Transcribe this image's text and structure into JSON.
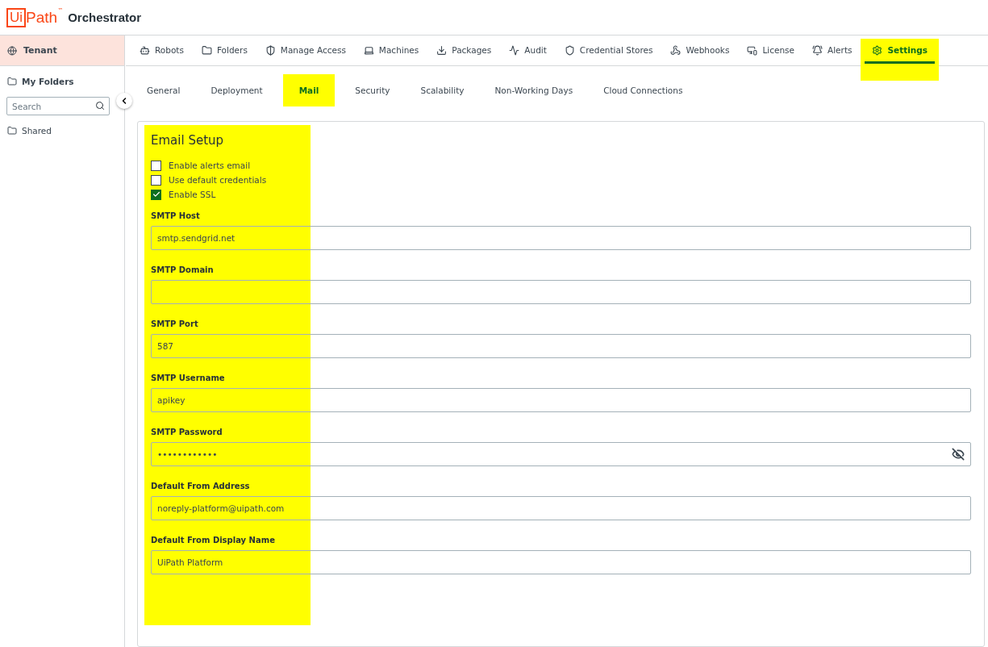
{
  "header": {
    "logo_mark": "Ui",
    "logo_word": "Path",
    "logo_tm": "™",
    "product": "Orchestrator"
  },
  "sidebar": {
    "tenant": "Tenant",
    "items": [
      {
        "label": "My Folders"
      },
      {
        "label": "Shared"
      }
    ],
    "search": {
      "placeholder": "Search"
    }
  },
  "nav_tabs": [
    {
      "label": "Robots",
      "selected": false,
      "highlighted": false
    },
    {
      "label": "Folders",
      "selected": false,
      "highlighted": false
    },
    {
      "label": "Manage Access",
      "selected": false,
      "highlighted": false
    },
    {
      "label": "Machines",
      "selected": false,
      "highlighted": false
    },
    {
      "label": "Packages",
      "selected": false,
      "highlighted": false
    },
    {
      "label": "Audit",
      "selected": false,
      "highlighted": false
    },
    {
      "label": "Credential Stores",
      "selected": false,
      "highlighted": false
    },
    {
      "label": "Webhooks",
      "selected": false,
      "highlighted": false
    },
    {
      "label": "License",
      "selected": false,
      "highlighted": false
    },
    {
      "label": "Alerts",
      "selected": false,
      "highlighted": false
    },
    {
      "label": "Settings",
      "selected": true,
      "highlighted": true
    }
  ],
  "settings_tabs": [
    {
      "label": "General",
      "selected": false,
      "highlighted": false
    },
    {
      "label": "Deployment",
      "selected": false,
      "highlighted": false
    },
    {
      "label": "Mail",
      "selected": true,
      "highlighted": true
    },
    {
      "label": "Security",
      "selected": false,
      "highlighted": false
    },
    {
      "label": "Scalability",
      "selected": false,
      "highlighted": false
    },
    {
      "label": "Non-Working Days",
      "selected": false,
      "highlighted": false
    },
    {
      "label": "Cloud Connections",
      "selected": false,
      "highlighted": false
    }
  ],
  "email_setup": {
    "title": "Email Setup",
    "highlighted": true,
    "options": [
      {
        "label": "Enable alerts email",
        "checked": false
      },
      {
        "label": "Use default credentials",
        "checked": false
      },
      {
        "label": "Enable SSL",
        "checked": true
      }
    ],
    "fields": [
      {
        "label": "SMTP Host",
        "value": "smtp.sendgrid.net",
        "kind": "text"
      },
      {
        "label": "SMTP Domain",
        "kind": "text"
      },
      {
        "label": "SMTP Port",
        "value": "587",
        "kind": "text"
      },
      {
        "label": "SMTP Username",
        "value": "apikey",
        "kind": "text"
      },
      {
        "label": "SMTP Password",
        "value": "••••••••••••",
        "kind": "password"
      },
      {
        "label": "Default From Address",
        "value": "noreply-platform@uipath.com",
        "kind": "text"
      },
      {
        "label": "Default From Display Name",
        "value": "UiPath Platform",
        "kind": "text"
      }
    ]
  }
}
